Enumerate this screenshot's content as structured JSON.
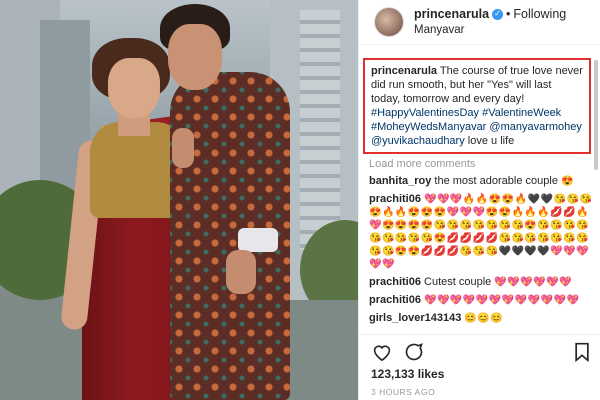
{
  "header": {
    "username": "princenarula",
    "follow_label": "Following",
    "location": "Manyavar",
    "verified_icon": "verified-badge-icon"
  },
  "caption": {
    "username": "princenarula",
    "text": "The course of true love never did run smooth, but her \"Yes\" will last today, tomorrow and every day!",
    "tags": [
      "#HappyValentinesDay",
      "#ValentineWeek",
      "#MoheyWedsManyavar",
      "@manyavarmohey",
      "@yuvikachaudhary"
    ],
    "tail": "love u life"
  },
  "load_more": "Load more comments",
  "comments": [
    {
      "user": "banhita_roy",
      "text": "the most adorable couple",
      "emoji": "😍"
    },
    {
      "user": "prachiti06",
      "text": "",
      "emoji": "💖💖💖🔥🔥😍😍🔥🖤🖤😘😘😘😍🔥🔥😍😍😍💖💖💖😍😍🔥🔥🔥💋💋🔥💖😍😍😍😍😘😘😘😘😘😘😘😍😘😘😘😘😘😘😘😘😘😍💋💋💋💋😘😘😘😘😘😘😘😘😘😍😍💋💋💋😘😘😘🖤🖤🖤🖤💖💖💖💖💖"
    },
    {
      "user": "prachiti06",
      "text": "Cutest couple",
      "emoji": "💖💖💖💖💖💖"
    },
    {
      "user": "prachiti06",
      "text": "",
      "emoji": "💖💖💖💖💖💖💖💖💖💖💖💖"
    },
    {
      "user": "girls_lover143143",
      "text": "",
      "emoji": "😊😊😊"
    }
  ],
  "actions": {
    "likes": "123,133 likes",
    "time": "3 HOURS AGO"
  },
  "colors": {
    "highlight_border": "#e0302b",
    "link": "#003569",
    "verified": "#3897f0",
    "muted": "#999999"
  }
}
